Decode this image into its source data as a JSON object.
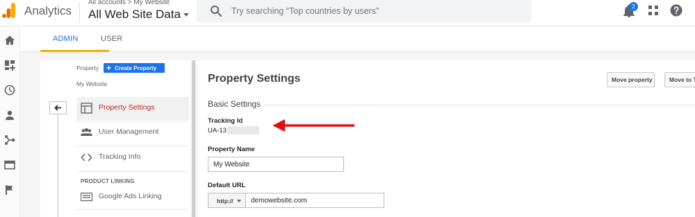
{
  "header": {
    "app_name": "Analytics",
    "account_breadcrumb": "All accounts > My Website",
    "account_view": "All Web Site Data",
    "search_placeholder": "Try searching “Top countries by users”",
    "notification_count": "2",
    "icons": [
      "analytics-logo-icon",
      "search-icon",
      "bell-icon",
      "apps-grid-icon",
      "help-icon"
    ],
    "brand_colors": {
      "logo_orange": "#f9ab00",
      "logo_dark_orange": "#e37400"
    }
  },
  "rail": {
    "icons": [
      "home-icon",
      "customization-icon",
      "realtime-clock-icon",
      "audience-person-icon",
      "acquisition-icon",
      "behavior-icon",
      "conversions-flag-icon"
    ]
  },
  "tabs": [
    {
      "label": "ADMIN",
      "active": true
    },
    {
      "label": "USER",
      "active": false
    }
  ],
  "property_column": {
    "label": "Property",
    "create_button": "Create Property",
    "property_name": "My Website",
    "nav_items": [
      {
        "label": "Property Settings",
        "icon": "property-settings-icon",
        "active": true
      },
      {
        "label": "User Management",
        "icon": "users-icon",
        "active": false
      },
      {
        "label": "Tracking Info",
        "icon": "code-icon",
        "active": false
      }
    ],
    "section_label": "PRODUCT LINKING",
    "linking_items": [
      {
        "label": "Google Ads Linking",
        "icon": "google-ads-icon"
      }
    ]
  },
  "settings": {
    "title": "Property Settings",
    "move_property_button": "Move property",
    "move_to_button": "Move to T",
    "basic_settings_heading": "Basic Settings",
    "tracking_id_label": "Tracking Id",
    "tracking_id_value": "UA-13",
    "property_name_label": "Property Name",
    "property_name_value": "My Website",
    "default_url_label": "Default URL",
    "url_protocol": "http://",
    "url_value": "demowebsite.com"
  },
  "colors": {
    "accent_blue": "#1a73e8",
    "tab_indicator": "#f9ab00",
    "active_nav_text": "#c5221f",
    "annotation_arrow": "#e01010"
  }
}
